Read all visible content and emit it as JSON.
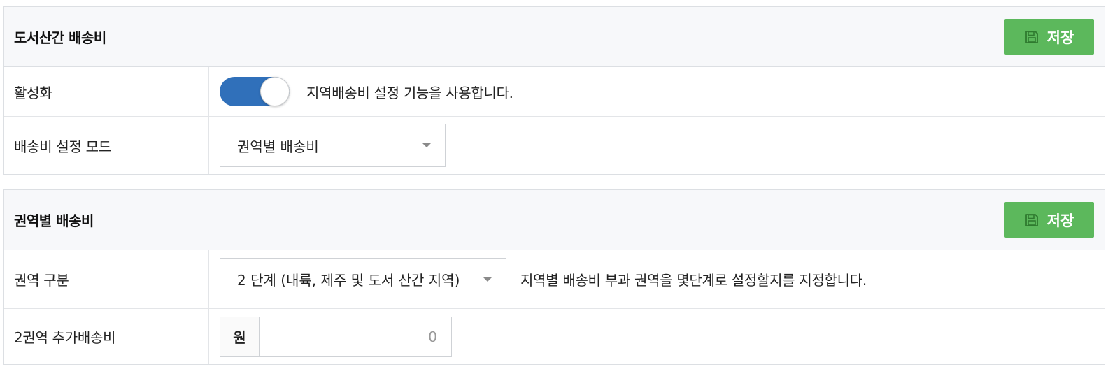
{
  "panel1": {
    "title": "도서산간 배송비",
    "save_label": "저장",
    "rows": {
      "activation": {
        "label": "활성화",
        "toggle_on": true,
        "description": "지역배송비 설정 기능을 사용합니다."
      },
      "mode": {
        "label": "배송비 설정 모드",
        "selected": "권역별 배송비"
      }
    }
  },
  "panel2": {
    "title": "권역별 배송비",
    "save_label": "저장",
    "rows": {
      "zone_division": {
        "label": "권역 구분",
        "selected": "2 단계 (내륙, 제주 및 도서 산간 지역)",
        "description": "지역별 배송비 부과 권역을 몇단계로 설정할지를 지정합니다."
      },
      "zone2_fee": {
        "label": "2권역 추가배송비",
        "currency": "원",
        "value": "0"
      }
    }
  },
  "colors": {
    "save_button": "#5cb85c",
    "toggle_on": "#3070ba",
    "header_bg": "#f7f8fa"
  },
  "icons": {
    "save": "save-icon",
    "dropdown": "caret-down-icon"
  }
}
